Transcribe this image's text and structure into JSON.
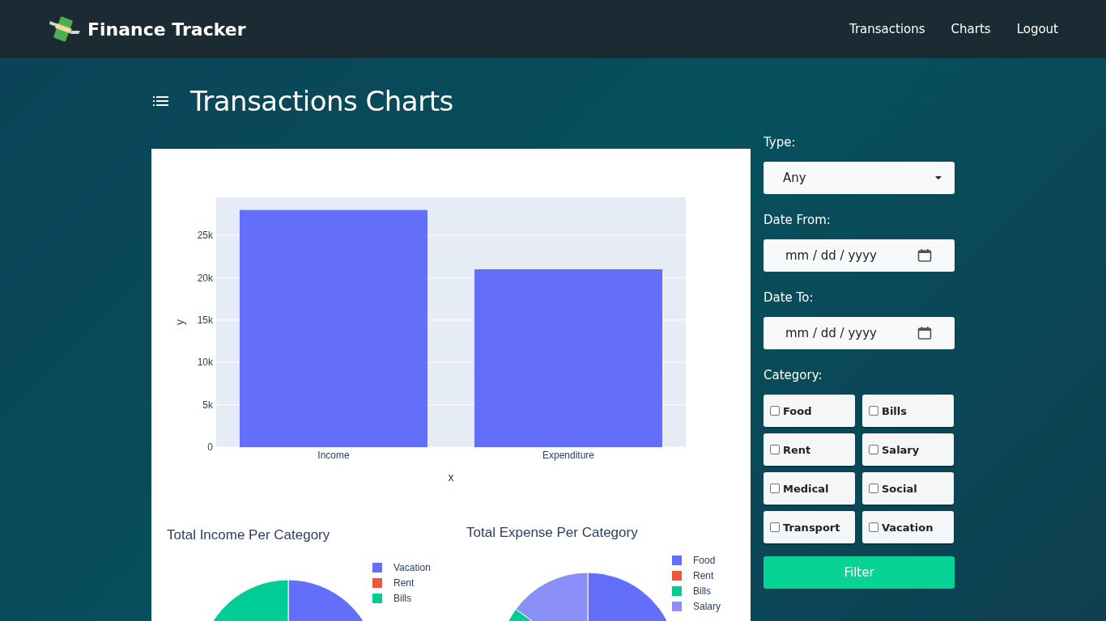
{
  "navbar": {
    "brand": "Finance Tracker",
    "links": [
      {
        "label": "Transactions"
      },
      {
        "label": "Charts"
      },
      {
        "label": "Logout"
      }
    ]
  },
  "page": {
    "title": "Transactions Charts"
  },
  "bar_chart": {
    "chart_data": {
      "type": "bar",
      "xlabel": "x",
      "ylabel": "y",
      "categories": [
        "Income",
        "Expenditure"
      ],
      "grid": true,
      "series": [
        {
          "color": "#636efa",
          "values": [
            28000,
            21000
          ]
        }
      ],
      "ylim": [
        0,
        29500
      ],
      "yticks": [
        0,
        {
          "value": 5000,
          "label": "5k"
        },
        {
          "value": 10000,
          "label": "10k"
        },
        {
          "value": 15000,
          "label": "15k"
        },
        {
          "value": 20000,
          "label": "20k"
        },
        {
          "value": 25000,
          "label": "25k"
        }
      ]
    }
  },
  "pies": [
    {
      "title": "Total Income Per Category",
      "legend": [
        {
          "label": "Vacation",
          "color": "#636efa"
        },
        {
          "label": "Rent",
          "color": "#ef553b"
        },
        {
          "label": "Bills",
          "color": "#00cc96"
        }
      ]
    },
    {
      "title": "Total Expense Per Category",
      "legend": [
        {
          "label": "Food",
          "color": "#636efa"
        },
        {
          "label": "Rent",
          "color": "#ef553b"
        },
        {
          "label": "Bills",
          "color": "#00cc96"
        },
        {
          "label": "Salary",
          "color": "#8a90f8"
        }
      ]
    }
  ],
  "filters": {
    "type": {
      "label": "Type:",
      "value": "Any"
    },
    "date_from": {
      "label": "Date From:",
      "placeholder": "mm / dd / yyyy"
    },
    "date_to": {
      "label": "Date To:",
      "placeholder": "mm / dd / yyyy"
    },
    "category_label": "Category:",
    "categories": [
      {
        "label": "Food",
        "checked": false
      },
      {
        "label": "Bills",
        "checked": false
      },
      {
        "label": "Rent",
        "checked": false
      },
      {
        "label": "Salary",
        "checked": false
      },
      {
        "label": "Medical",
        "checked": false
      },
      {
        "label": "Social",
        "checked": false
      },
      {
        "label": "Transport",
        "checked": false
      },
      {
        "label": "Vacation",
        "checked": false
      }
    ],
    "button": "Filter"
  }
}
